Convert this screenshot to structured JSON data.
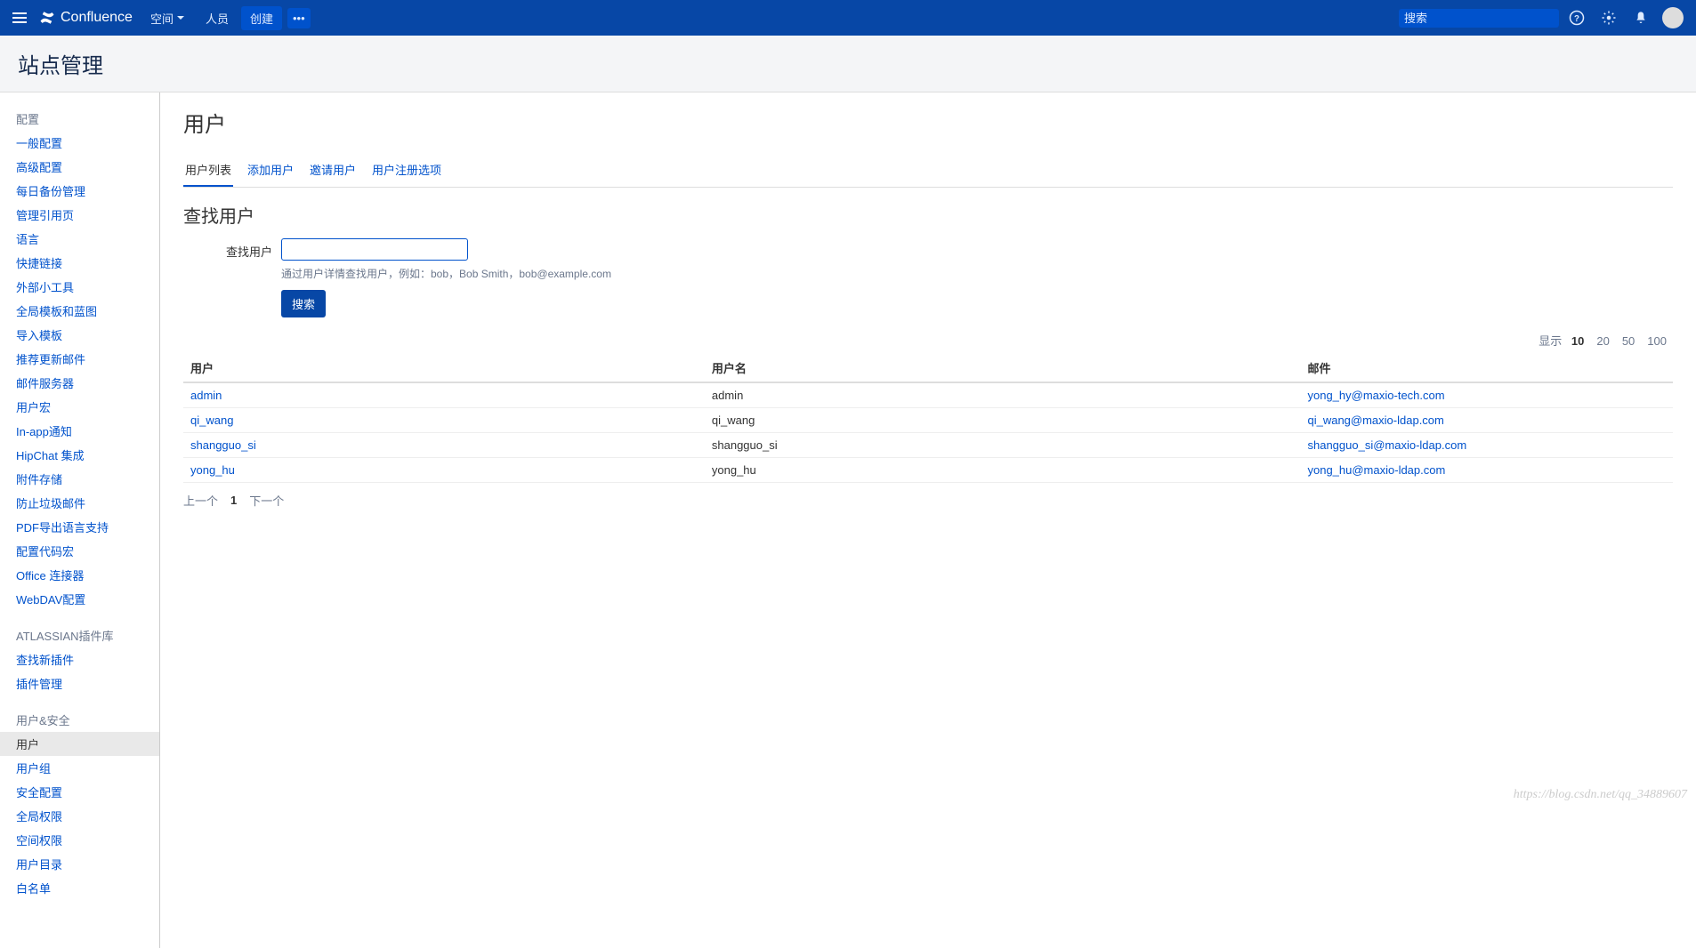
{
  "topnav": {
    "brand": "Confluence",
    "spaces": "空间",
    "people": "人员",
    "create": "创建",
    "search_placeholder": "搜索"
  },
  "page_title": "站点管理",
  "sidebar": {
    "sections": [
      {
        "heading": "配置",
        "items": [
          "一般配置",
          "高级配置",
          "每日备份管理",
          "管理引用页",
          "语言",
          "快捷链接",
          "外部小工具",
          "全局模板和蓝图",
          "导入模板",
          "推荐更新邮件",
          "邮件服务器",
          "用户宏",
          "In-app通知",
          "HipChat 集成",
          "附件存储",
          "防止垃圾邮件",
          "PDF导出语言支持",
          "配置代码宏",
          "Office 连接器",
          "WebDAV配置"
        ]
      },
      {
        "heading": "ATLASSIAN插件库",
        "items": [
          "查找新插件",
          "插件管理"
        ]
      },
      {
        "heading": "用户&安全",
        "items": [
          "用户",
          "用户组",
          "安全配置",
          "全局权限",
          "空间权限",
          "用户目录",
          "白名单"
        ]
      }
    ],
    "active": "用户"
  },
  "main": {
    "heading": "用户",
    "tabs": [
      "用户列表",
      "添加用户",
      "邀请用户",
      "用户注册选项"
    ],
    "active_tab": "用户列表",
    "find_section_title": "查找用户",
    "find_label": "查找用户",
    "find_help": "通过用户详情查找用户，例如：bob，Bob Smith，bob@example.com",
    "search_button": "搜索",
    "show_label": "显示",
    "show_options": [
      "10",
      "20",
      "50",
      "100"
    ],
    "show_active": "10",
    "columns": {
      "user": "用户",
      "username": "用户名",
      "email": "邮件"
    },
    "rows": [
      {
        "user": "admin",
        "username": "admin",
        "email": "yong_hy@maxio-tech.com"
      },
      {
        "user": "qi_wang",
        "username": "qi_wang",
        "email": "qi_wang@maxio-ldap.com"
      },
      {
        "user": "shangguo_si",
        "username": "shangguo_si",
        "email": "shangguo_si@maxio-ldap.com"
      },
      {
        "user": "yong_hu",
        "username": "yong_hu",
        "email": "yong_hu@maxio-ldap.com"
      }
    ],
    "pager": {
      "prev": "上一个",
      "current": "1",
      "next": "下一个"
    }
  },
  "watermark": "https://blog.csdn.net/qq_34889607"
}
